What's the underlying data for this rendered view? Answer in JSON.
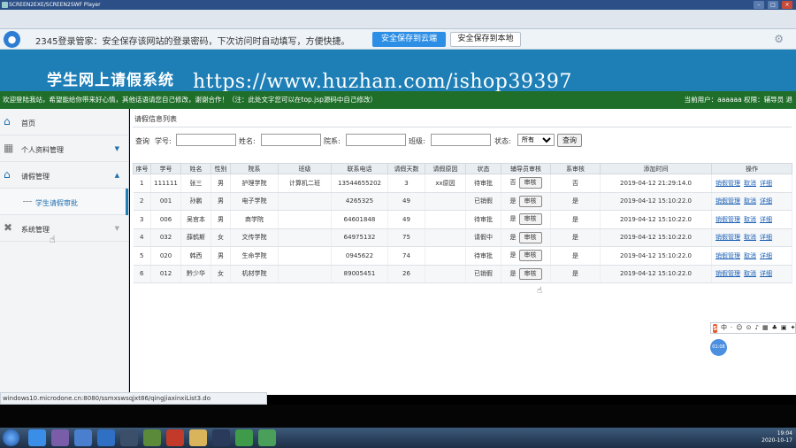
{
  "player": {
    "title": "SCREEN2EXE/SCREEN2SWF Player"
  },
  "pwbar": {
    "message": "2345登录管家：安全保存该网站的登录密码，下次访问时自动填写，方便快捷。",
    "btn_cloud": "安全保存到云端",
    "btn_local": "安全保存到本地"
  },
  "header": {
    "title": "学生网上请假系统",
    "watermark": "https://www.huzhan.com/ishop39397"
  },
  "notice": {
    "text": "欢迎登陆我站，希望能给你带来好心情，其他话语请您自己修改，谢谢合作！（注：此处文字您可以在top.jsp源码中自己修改）",
    "user_info": "当前用户：aaaaaa 权限：辅导员 退"
  },
  "sidebar": {
    "home": "首页",
    "profile": "个人资料管理",
    "leave": "请假管理",
    "leave_audit": "学生请假审批",
    "system": "系统管理"
  },
  "panel": {
    "title": "请假信息列表"
  },
  "search": {
    "query_label": "查询",
    "student_id_label": "学号:",
    "name_label": "姓名:",
    "dept_label": "院系:",
    "class_label": "班级:",
    "status_label": "状态:",
    "status_value": "所有",
    "query_btn": "查询"
  },
  "table": {
    "headers": [
      "序号",
      "学号",
      "姓名",
      "性别",
      "院系",
      "班级",
      "联系电话",
      "请假天数",
      "请假原因",
      "状态",
      "辅导员审核",
      "系审核",
      "添加时间",
      "操作"
    ],
    "audit_btn": "审核",
    "op_labels": [
      "销假管理",
      "取消",
      "详细"
    ],
    "rows": [
      [
        "1",
        "111111",
        "张三",
        "男",
        "护理学院",
        "计算机二班",
        "13544655202",
        "3",
        "xx原因",
        "待审批",
        "否",
        "否",
        "2019-04-12 21:29:14.0"
      ],
      [
        "2",
        "001",
        "孙鹏",
        "男",
        "电子学院",
        "",
        "4265325",
        "49",
        "",
        "已销假",
        "是",
        "是",
        "2019-04-12 15:10:22.0"
      ],
      [
        "3",
        "006",
        "吴官本",
        "男",
        "商学院",
        "",
        "64601848",
        "49",
        "",
        "待审批",
        "是",
        "是",
        "2019-04-12 15:10:22.0"
      ],
      [
        "4",
        "032",
        "薛鹤斯",
        "女",
        "文传学院",
        "",
        "64975132",
        "75",
        "",
        "请假中",
        "是",
        "是",
        "2019-04-12 15:10:22.0"
      ],
      [
        "5",
        "020",
        "韩西",
        "男",
        "生命学院",
        "",
        "0945622",
        "74",
        "",
        "待审批",
        "是",
        "是",
        "2019-04-12 15:10:22.0"
      ],
      [
        "6",
        "012",
        "黔少华",
        "女",
        "机材学院",
        "",
        "89005451",
        "26",
        "",
        "已销假",
        "是",
        "是",
        "2019-04-12 15:10:22.0"
      ]
    ]
  },
  "status_url": "windows10.microdone.cn:8080/ssmxswsqjxt86/qingjiaxinxiList3.do",
  "ime": {
    "logo": "S",
    "items": [
      "中",
      "·",
      "☺",
      "⊙",
      "♪",
      "▦",
      "♣",
      "▣",
      "✦"
    ]
  },
  "bubble": "01:08",
  "tray": {
    "time": "19:04",
    "date": "2020-10-17"
  }
}
